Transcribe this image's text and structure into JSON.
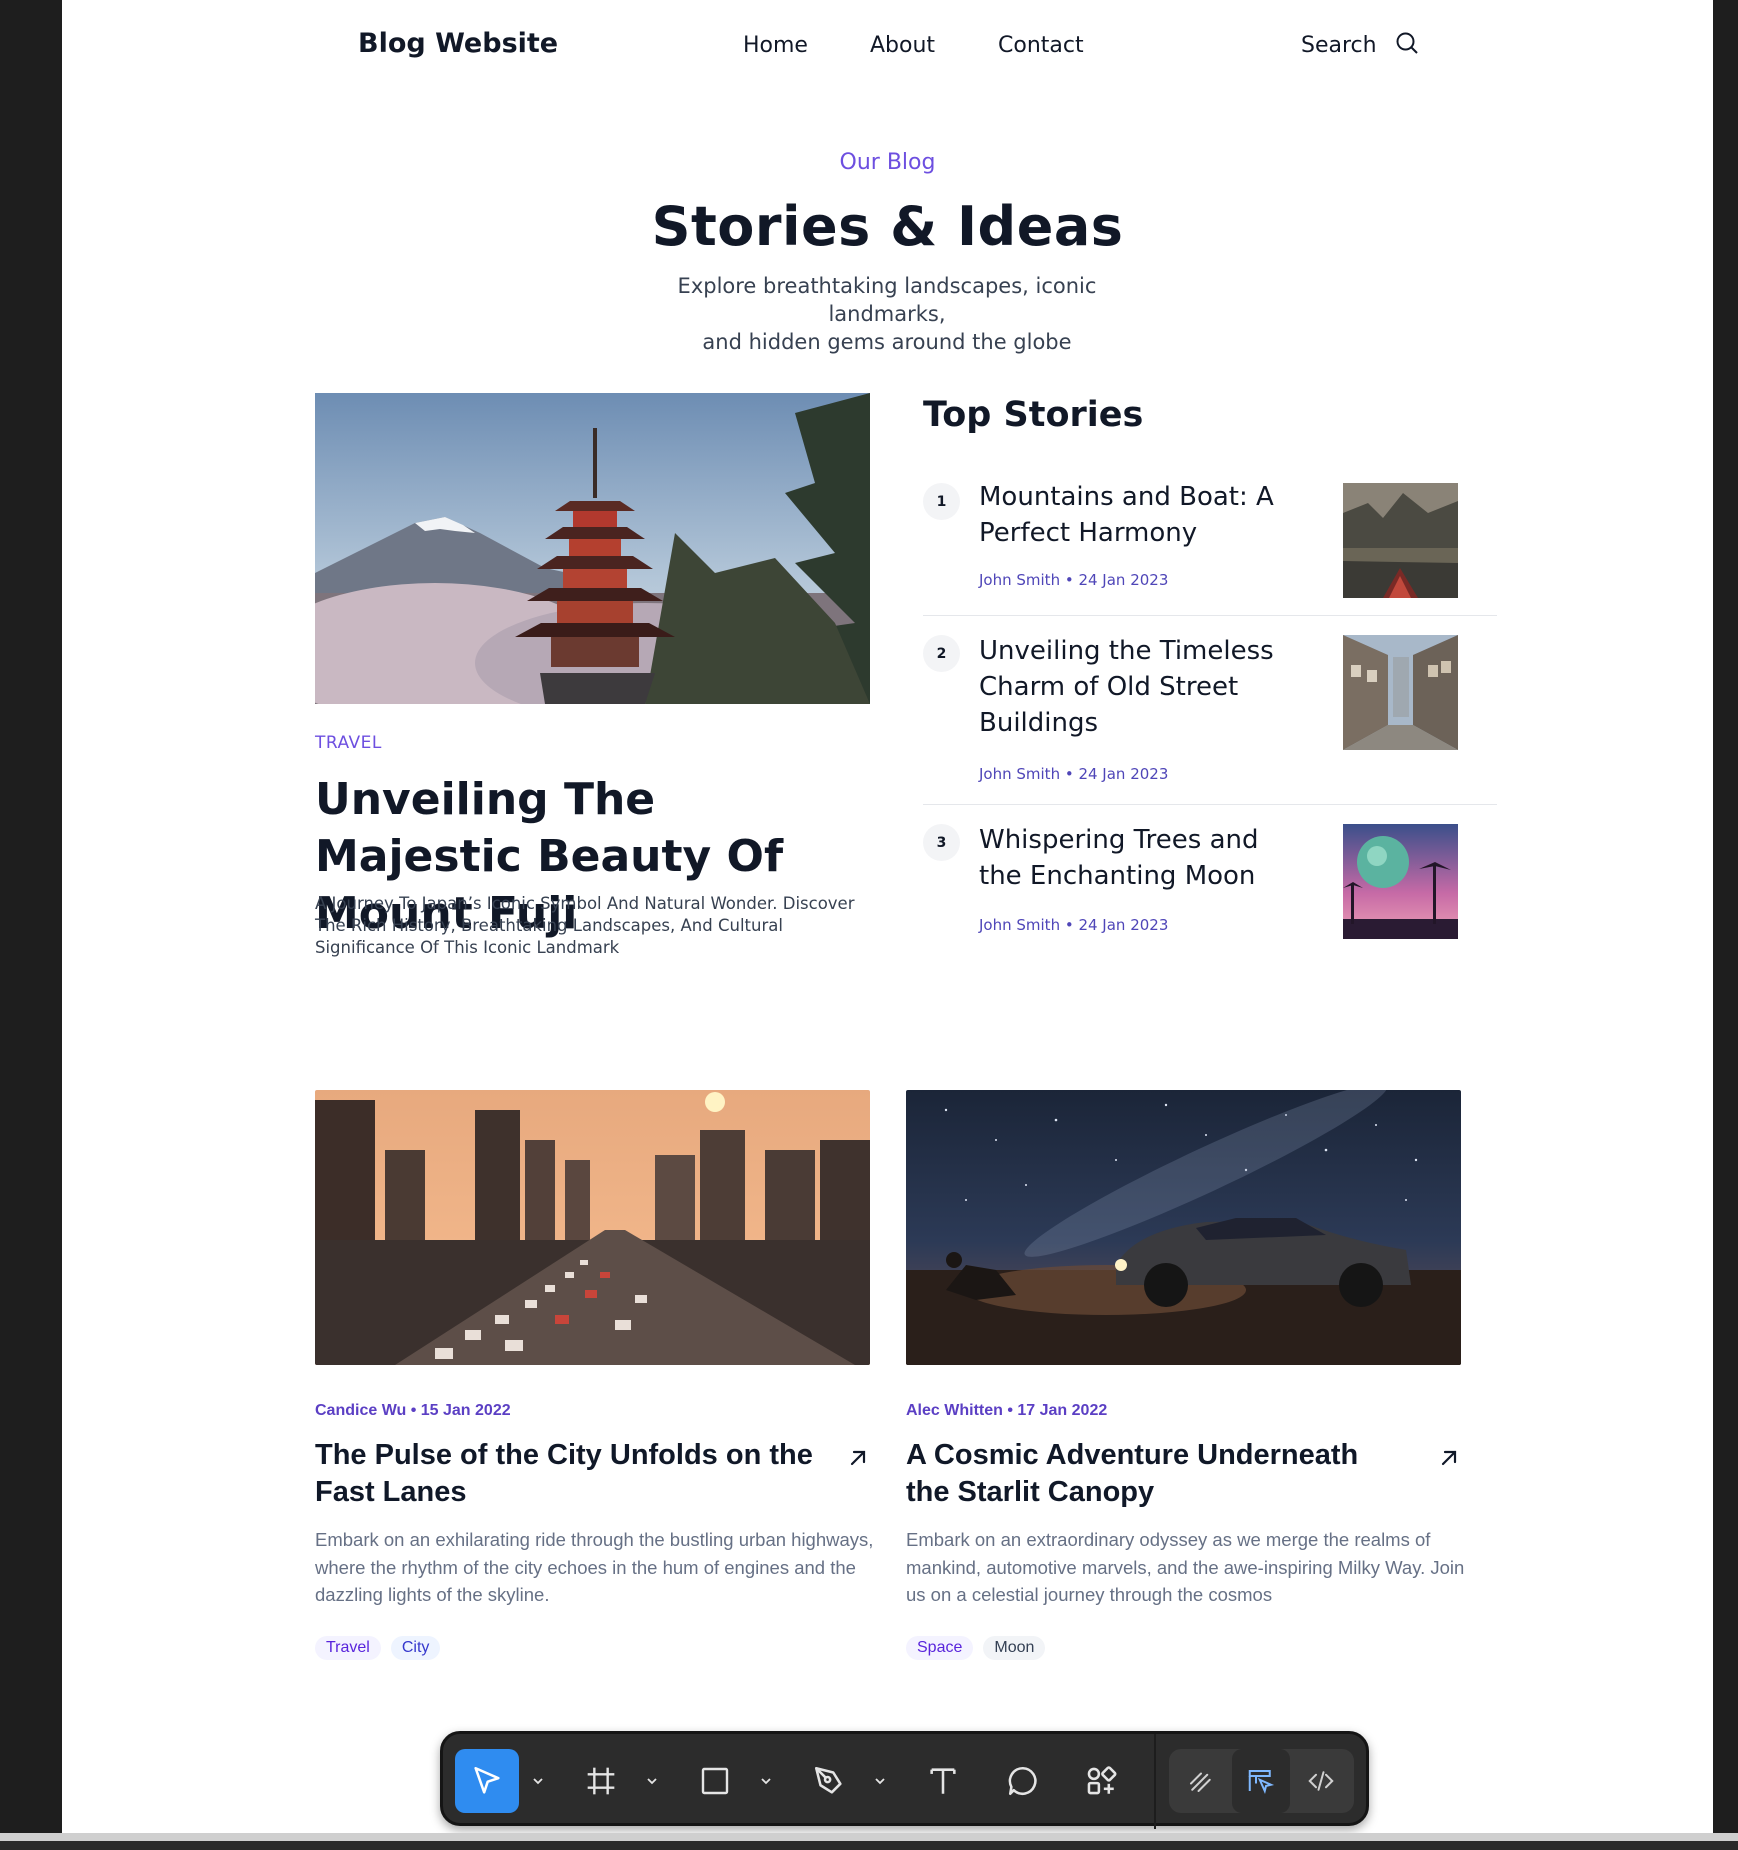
{
  "nav": {
    "logo": "Blog Website",
    "links": [
      "Home",
      "About",
      "Contact"
    ],
    "search_label": "Search"
  },
  "hero": {
    "eyebrow": "Our Blog",
    "headline": "Stories & Ideas",
    "subtitle_line1": "Explore breathtaking landscapes, iconic landmarks,",
    "subtitle_line2": "and hidden gems around the globe"
  },
  "featured": {
    "category": "TRAVEL",
    "title": "Unveiling The Majestic Beauty Of Mount Fuji",
    "description": "A Journey To Japan’s  Iconic Symbol And Natural Wonder. Discover The Rich History, Breathtaking Landscapes, And Cultural Significance Of This Iconic Landmark"
  },
  "top_stories": {
    "heading": "Top Stories",
    "items": [
      {
        "num": "1",
        "title": "Mountains and Boat: A Perfect Harmony",
        "meta": "John Smith • 24 Jan 2023"
      },
      {
        "num": "2",
        "title": "Unveiling the Timeless Charm of Old Street Buildings",
        "meta": "John Smith • 24 Jan 2023"
      },
      {
        "num": "3",
        "title": "Whispering Trees and the Enchanting Moon",
        "meta": "John Smith • 24 Jan 2023"
      }
    ]
  },
  "cards": [
    {
      "meta": "Candice Wu • 15 Jan 2022",
      "title": "The Pulse of the City Unfolds on the Fast Lanes",
      "description": "Embark on an exhilarating ride through the bustling urban highways, where the rhythm of the city echoes in the hum of engines and the dazzling lights of the skyline.",
      "tags": [
        "Travel",
        "City"
      ]
    },
    {
      "meta": "Alec Whitten • 17 Jan 2022",
      "title": "A Cosmic Adventure Underneath the Starlit Canopy",
      "description": "Embark on an extraordinary odyssey as we merge the realms of mankind, automotive marvels, and the awe-inspiring Milky Way. Join us on a celestial journey through the cosmos",
      "tags": [
        "Space",
        "Moon"
      ]
    }
  ],
  "toolbar": {
    "tools": [
      "move-tool-icon",
      "frame-tool-icon",
      "rectangle-tool-icon",
      "pen-tool-icon",
      "text-tool-icon",
      "comment-tool-icon",
      "actions-icon"
    ],
    "modes": [
      "draw-mode-icon",
      "design-mode-icon",
      "dev-mode-icon"
    ]
  },
  "colors": {
    "accent": "#6d4fe0",
    "toolbar_active": "#2f8cf0",
    "app_frame": "#1e1e1e"
  }
}
